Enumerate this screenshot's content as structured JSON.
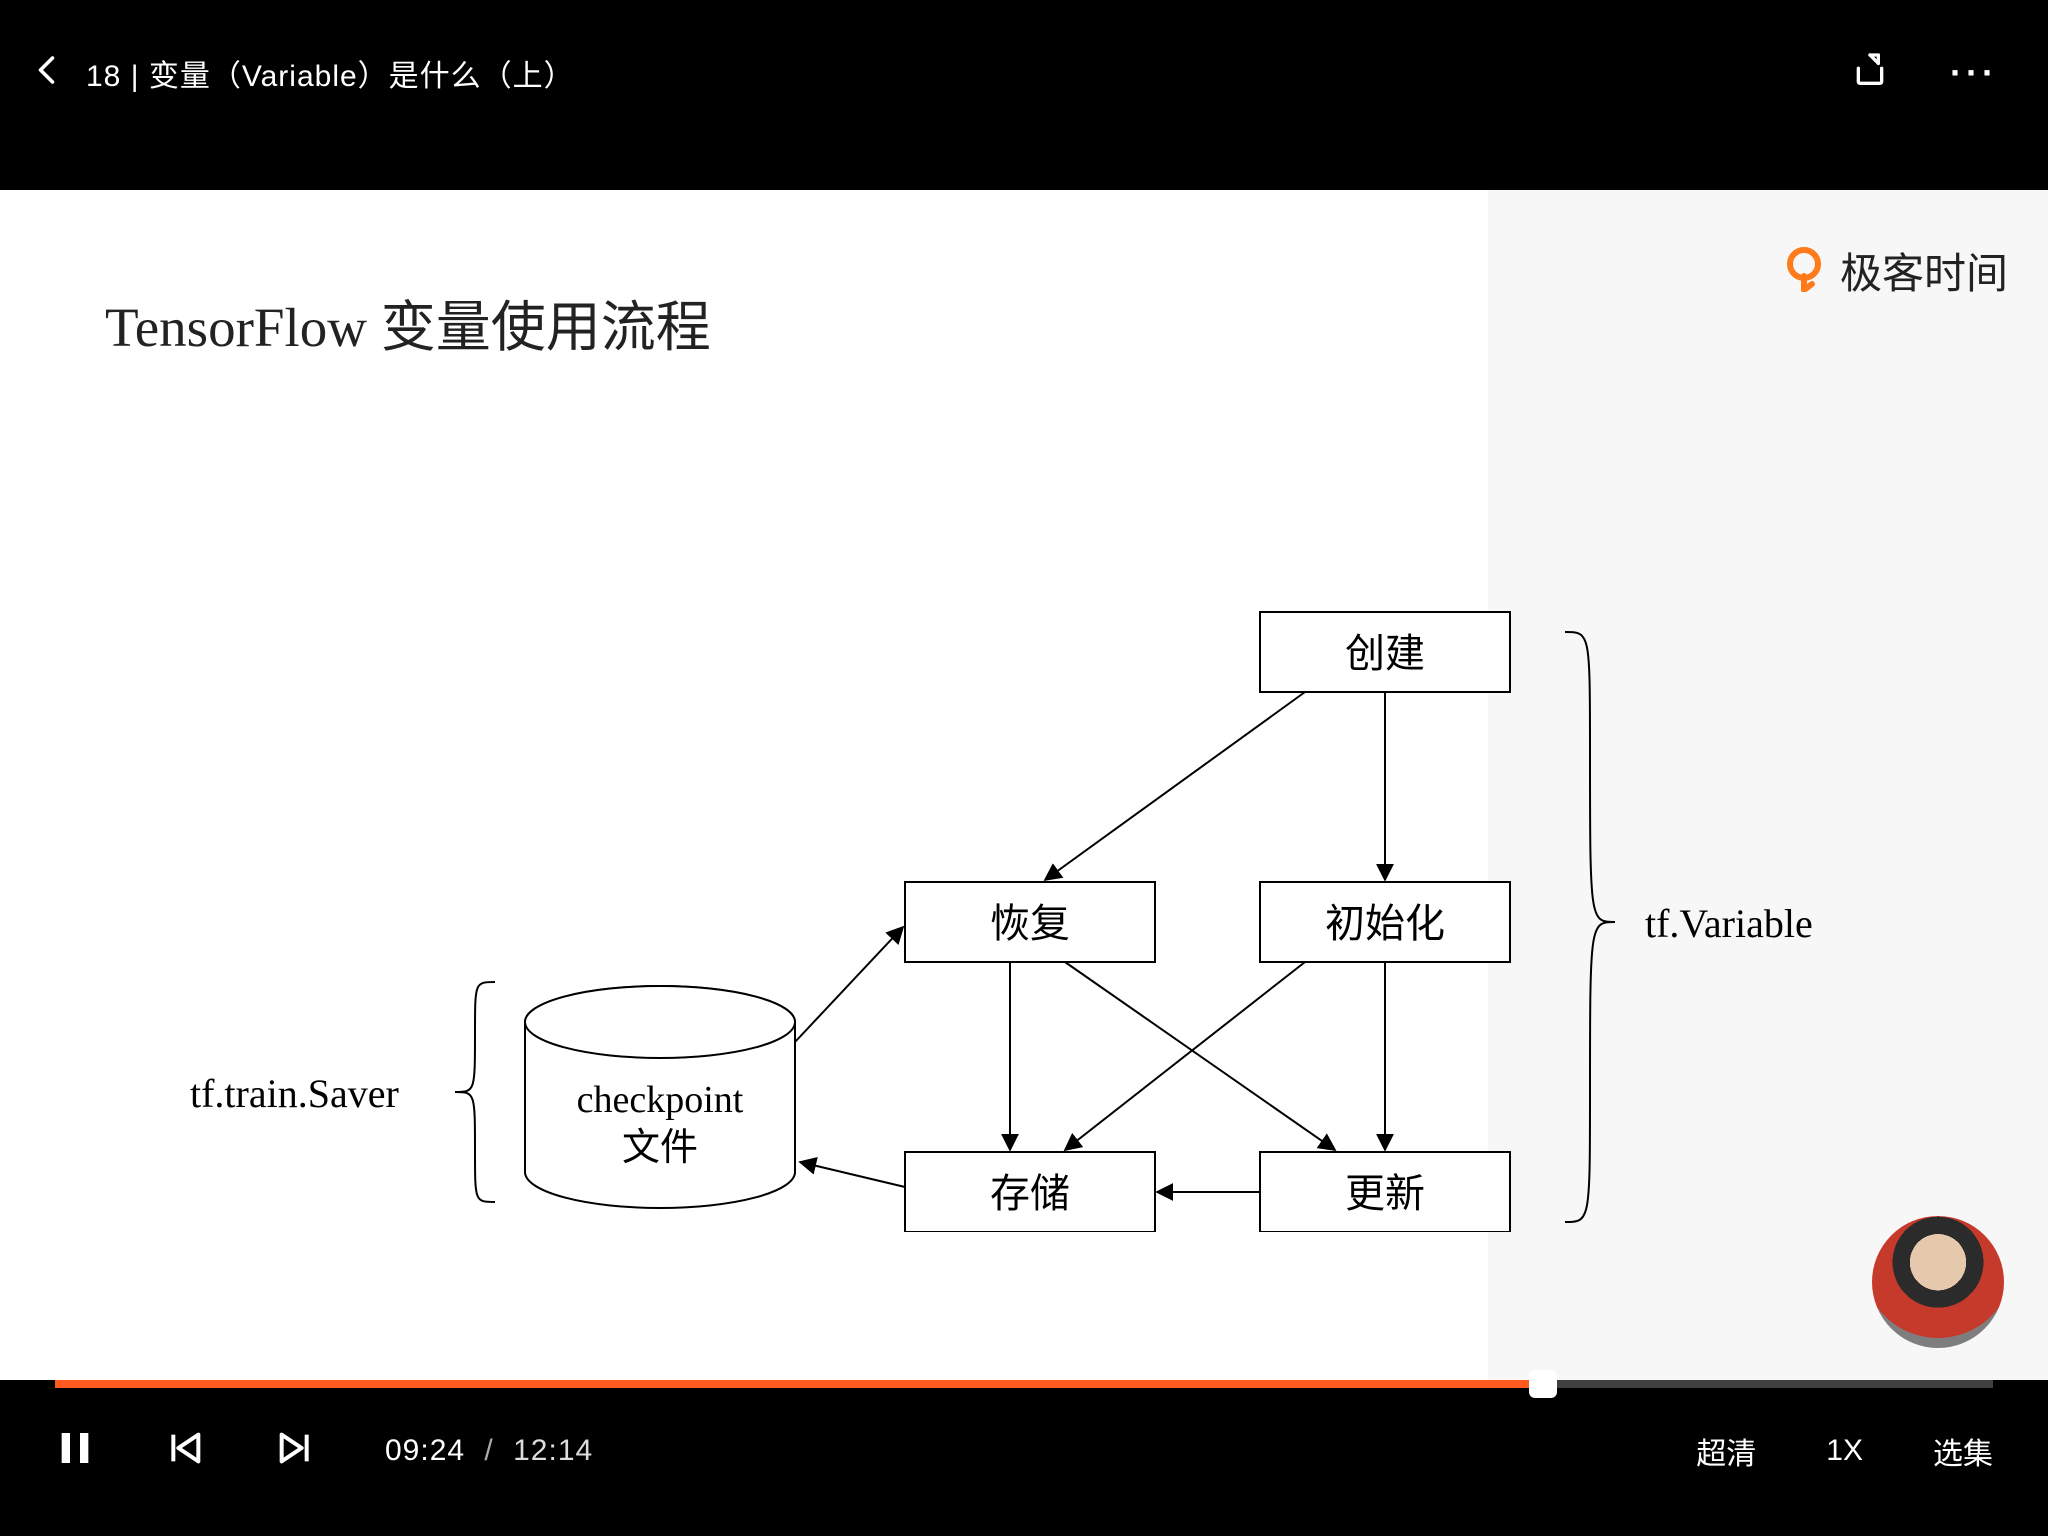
{
  "header": {
    "title": "18 | 变量（Variable）是什么（上）"
  },
  "brand": {
    "name": "极客时间"
  },
  "slide": {
    "title": "TensorFlow 变量使用流程",
    "left_label": "tf.train.Saver",
    "right_label": "tf.Variable",
    "cylinder_line1": "checkpoint",
    "cylinder_line2": "文件",
    "nodes": {
      "create": "创建",
      "restore": "恢复",
      "init": "初始化",
      "save": "存储",
      "update": "更新"
    }
  },
  "player": {
    "current_time": "09:24",
    "duration": "12:14",
    "progress_percent": 76.8,
    "quality": "超清",
    "speed": "1X",
    "episodes": "选集"
  }
}
